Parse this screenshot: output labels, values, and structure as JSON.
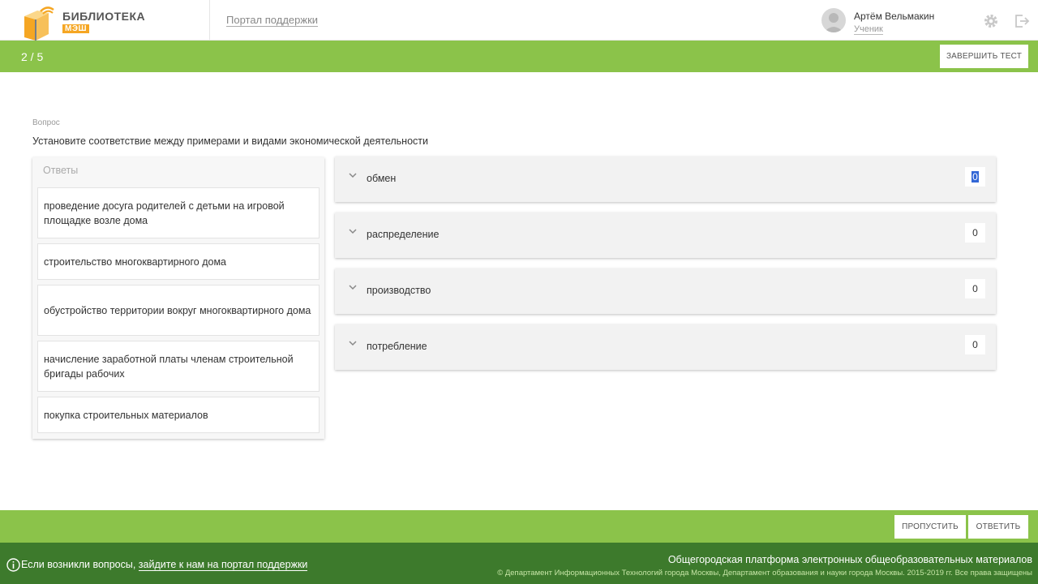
{
  "header": {
    "logo_title": "БИБЛИОТЕКА",
    "logo_sub": "МЭШ",
    "support_link": "Портал поддержки",
    "user_name": "Артём Вельмакин",
    "user_role": "Ученик"
  },
  "test_bar": {
    "progress": "2 / 5",
    "finish_label": "ЗАВЕРШИТЬ ТЕСТ"
  },
  "question": {
    "label": "Вопрос",
    "text": "Установите соответствие между примерами и видами экономической деятельности"
  },
  "answers": {
    "header": "Ответы",
    "items": [
      {
        "text": "проведение досуга родителей с детьми на игровой площадке возле дома"
      },
      {
        "text": "строительство многоквартирного дома"
      },
      {
        "text": "обустройство территории вокруг многоквартирного дома"
      },
      {
        "text": "начисление заработной платы членам строительной бригады рабочих"
      },
      {
        "text": "покупка строительных материалов"
      }
    ]
  },
  "categories": [
    {
      "label": "обмен",
      "count": "0",
      "selected": true
    },
    {
      "label": "распределение",
      "count": "0"
    },
    {
      "label": "производство",
      "count": "0"
    },
    {
      "label": "потребление",
      "count": "0"
    }
  ],
  "actions": {
    "skip_label": "ПРОПУСТИТЬ",
    "answer_label": "ОТВЕТИТЬ"
  },
  "footer": {
    "help_prefix": "Если возникли вопросы, ",
    "help_link": "зайдите к нам на портал поддержки",
    "platform": "Общегородская платформа электронных общеобразовательных материалов",
    "copyright": "© Департамент Информационных Технологий города Москвы, Департамент образования и науки города Москвы. 2015-2019 гг. Все права защищены"
  },
  "colors": {
    "accent_green": "#8bc34a",
    "footer_green": "#3d7a2c",
    "logo_orange": "#f5a623"
  },
  "icons": [
    "library-logo-icon",
    "user-avatar-icon",
    "gear-icon",
    "logout-icon",
    "chevron-down-icon",
    "info-icon"
  ]
}
